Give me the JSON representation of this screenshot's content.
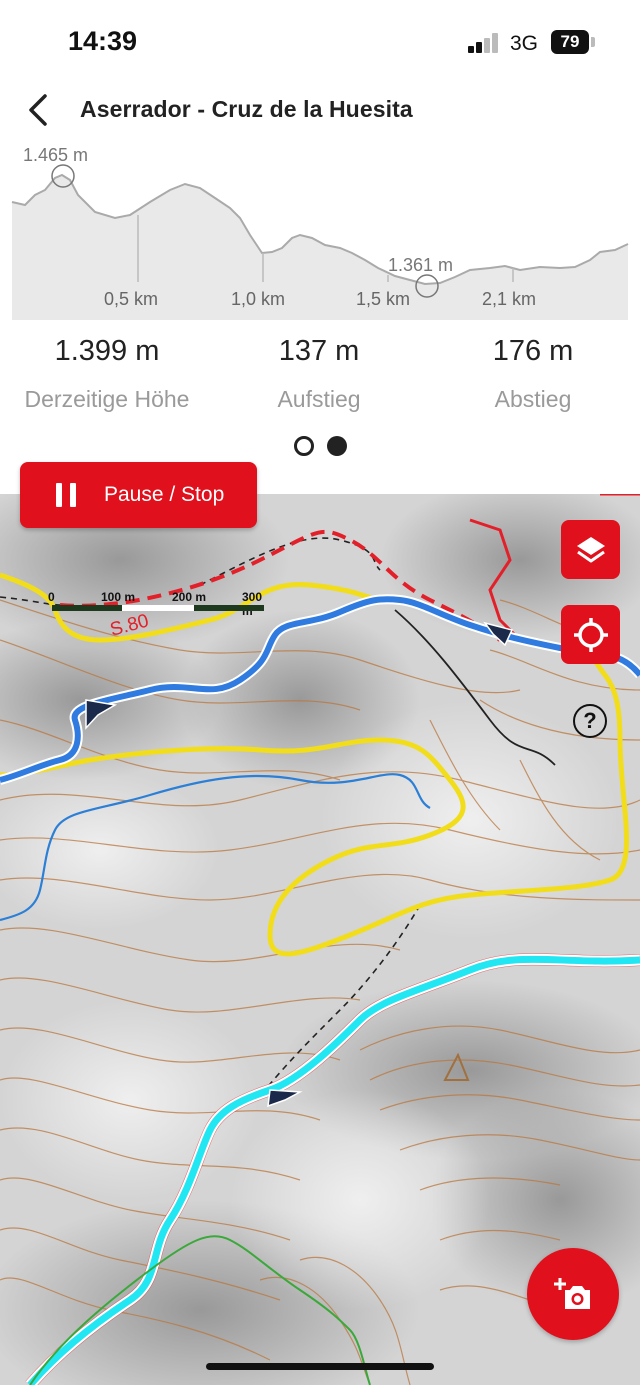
{
  "status": {
    "time": "14:39",
    "network": "3G",
    "battery": "79"
  },
  "header": {
    "title": "Aserrador - Cruz de la Huesita"
  },
  "profile": {
    "max_label": "1.465 m",
    "min_label": "1.361 m",
    "distances": [
      "0,5 km",
      "1,0 km",
      "1,5 km",
      "2,1 km"
    ]
  },
  "stats": [
    {
      "value": "1.399 m",
      "label": "Derzeitige Höhe"
    },
    {
      "value": "137 m",
      "label": "Aufstieg"
    },
    {
      "value": "176 m",
      "label": "Abstieg"
    }
  ],
  "pager": {
    "count": 2,
    "active": 1
  },
  "pause": {
    "label": "Pause / Stop"
  },
  "map": {
    "scale_labels": [
      "0",
      "100 m",
      "200 m",
      "300 m"
    ],
    "trail_label": "S.80",
    "help_symbol": "?"
  },
  "icons": {
    "back": "chevron-left-icon",
    "layers": "layers-icon",
    "locate": "crosshair-icon",
    "help": "help-circle-icon",
    "add_photo": "camera-plus-icon"
  },
  "colors": {
    "accent": "#e0101c",
    "route_blue": "#2f7be0",
    "route_cyan": "#22e6f2",
    "route_yellow": "#f2dd1a",
    "contour": "#b9773e"
  }
}
